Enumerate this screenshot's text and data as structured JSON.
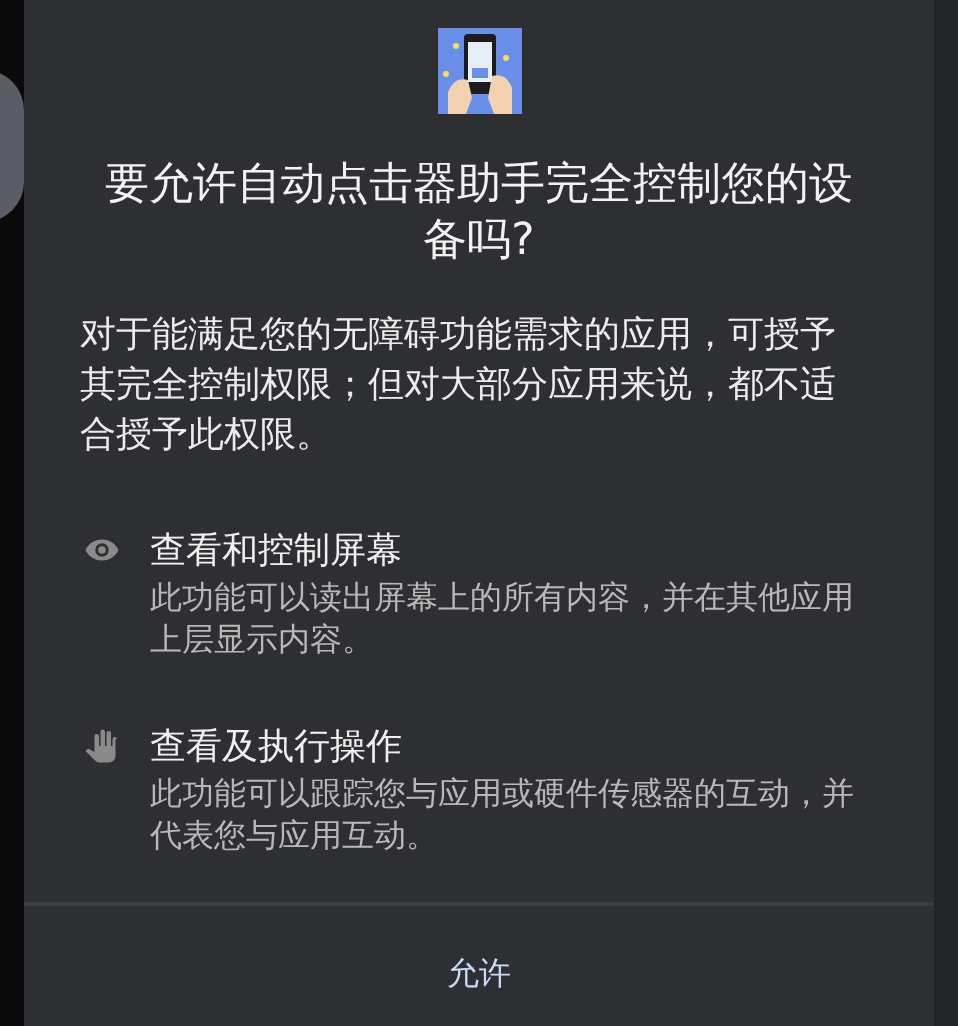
{
  "dialog": {
    "title": "要允许自动点击器助手完全控制您的设备吗?",
    "message": "对于能满足您的无障碍功能需求的应用，可授予其完全控制权限；但对大部分应用来说，都不适合授予此权限。",
    "permissions": [
      {
        "kind": "view",
        "title": "查看和控制屏幕",
        "description": "此功能可以读出屏幕上的所有内容，并在其他应用上层显示内容。"
      },
      {
        "kind": "act",
        "title": "查看及执行操作",
        "description": "此功能可以跟踪您与应用或硬件传感器的互动，并代表您与应用互动。"
      }
    ],
    "button": "允许"
  }
}
